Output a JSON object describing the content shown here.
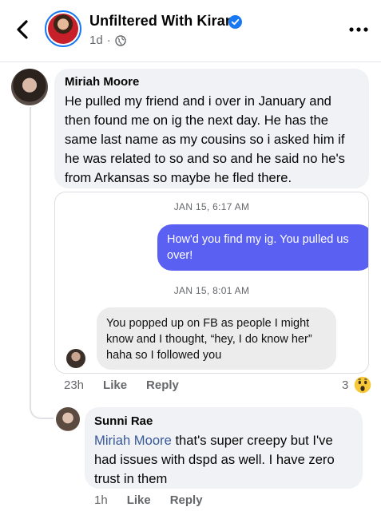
{
  "header": {
    "page_name": "Unfiltered With Kiran",
    "time": "1d",
    "dot": "·",
    "icons": {
      "back": "chevron-left-icon",
      "verified": "verified-badge-icon",
      "privacy": "globe-icon",
      "more": "more-options-icon"
    },
    "accent": "#1877f2"
  },
  "comments": [
    {
      "author": "Miriah Moore",
      "text": "He pulled my friend and i over in January and then found me on ig the next day. He has the same last name as my cousins so i asked him if he was related to so and so and he said no he's from Arkansas so maybe he fled there.",
      "attachment": {
        "timestamp1": "JAN 15, 6:17 AM",
        "sent_message": "How'd you find my ig. You pulled us over!",
        "timestamp2": "JAN 15, 8:01 AM",
        "received_message": "You popped up on FB as people I might know and I thought, “hey, I do know her” haha so I followed you",
        "sent_bubble_color": "#5960f2"
      },
      "time": "23h",
      "like_label": "Like",
      "reply_label": "Reply",
      "reaction_count": "3",
      "reaction_icon": "wow-emoji-icon"
    },
    {
      "author": "Sunni Rae",
      "mention": "Miriah Moore",
      "text": " that's super creepy but I've had issues with dspd as well. I have zero trust in them",
      "time": "1h",
      "like_label": "Like",
      "reply_label": "Reply",
      "mention_color": "#385898"
    }
  ]
}
